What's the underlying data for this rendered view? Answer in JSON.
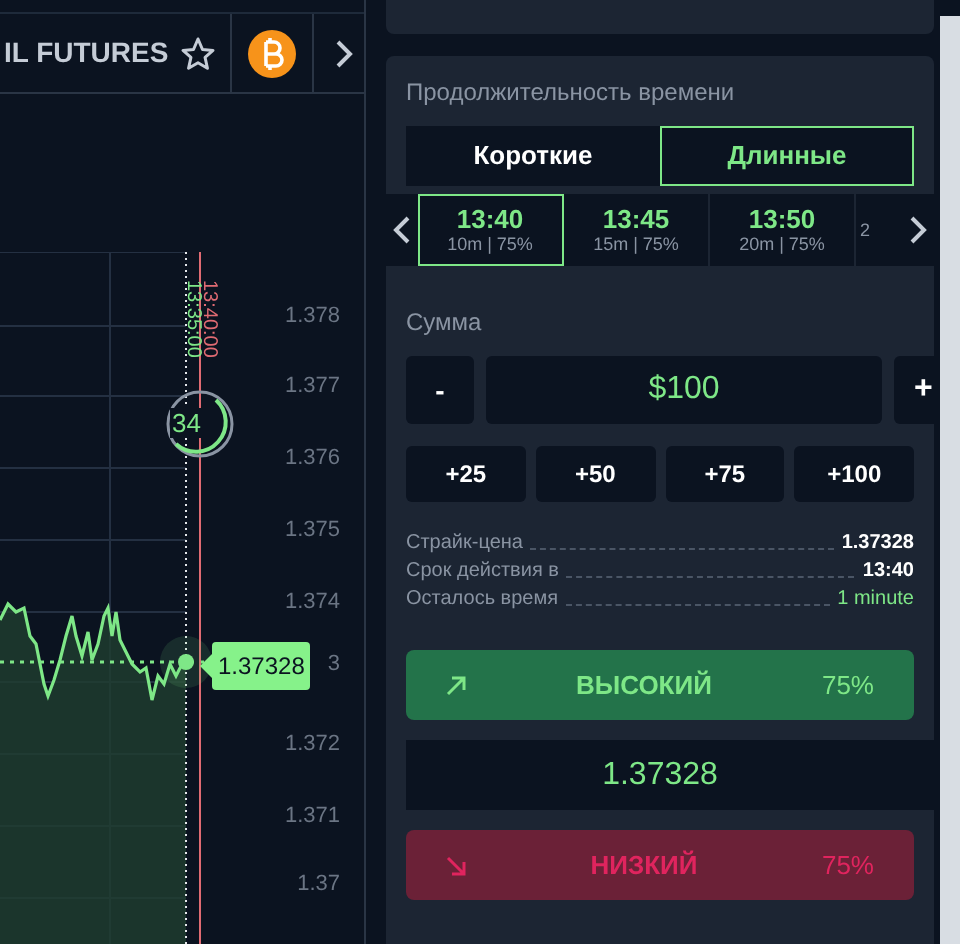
{
  "header": {
    "asset": "IL FUTURES",
    "favorite": false
  },
  "chart": {
    "y_axis_labels": [
      "1.378",
      "1.377",
      "1.376",
      "1.375",
      "1.374",
      "3",
      "1.372",
      "1.371",
      "1.37"
    ],
    "time_markers": [
      {
        "label": "13:40:00",
        "kind": "expiry"
      },
      {
        "label": "13:35:00",
        "kind": "purchase"
      }
    ],
    "countdown": "34",
    "current_price": "1.37328"
  },
  "duration": {
    "title": "Продолжительность времени",
    "tabs": [
      {
        "label": "Короткие",
        "selected": false
      },
      {
        "label": "Длинные",
        "selected": true
      }
    ],
    "slots": [
      {
        "time": "13:40",
        "detail": "10m | 75%",
        "selected": true
      },
      {
        "time": "13:45",
        "detail": "15m | 75%",
        "selected": false
      },
      {
        "time": "13:50",
        "detail": "20m | 75%",
        "selected": false
      },
      {
        "detail": "2",
        "selected": false
      }
    ]
  },
  "amount": {
    "title": "Сумма",
    "decrease": "-",
    "value": "$100",
    "increase": "+",
    "presets": [
      "+25",
      "+50",
      "+75",
      "+100"
    ]
  },
  "info": [
    {
      "label": "Страйк-цена",
      "value": "1.37328",
      "kind": "plain"
    },
    {
      "label": "Срок действия в",
      "value": "13:40",
      "kind": "plain"
    },
    {
      "label": "Осталось время",
      "value": "1 minute",
      "kind": "highlight"
    }
  ],
  "high_button": {
    "label": "ВЫСОКИЙ",
    "payout": "75%"
  },
  "price": "1.37328",
  "low_button": {
    "label": "НИЗКИЙ",
    "payout": "75%"
  }
}
